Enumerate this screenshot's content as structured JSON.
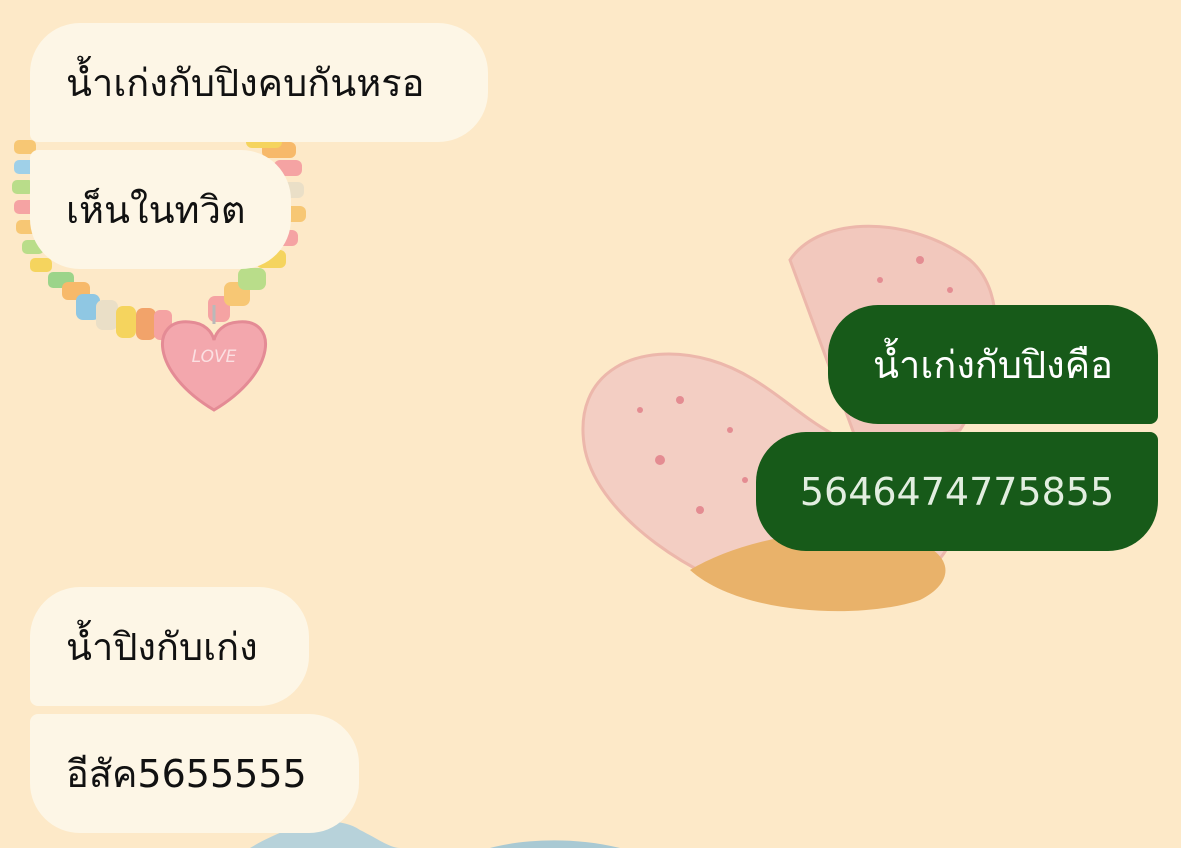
{
  "wallpaper": {
    "background_color": "#fde9c8",
    "decorations": [
      "candy-bracelet-icon",
      "heart-cookie-icon",
      "blue-ribbon-icon"
    ]
  },
  "colors": {
    "incoming_bubble": "#fdf6e6",
    "outgoing_bubble": "#175a19",
    "incoming_text": "#111111",
    "outgoing_text": "#ffffff"
  },
  "messages": [
    {
      "direction": "incoming",
      "text": "น้ำเก่งกับปิงคบกันหรอ"
    },
    {
      "direction": "incoming",
      "text": "เห็นในทวิต"
    },
    {
      "direction": "outgoing",
      "text": "น้ำเก่งกับปิงคือ"
    },
    {
      "direction": "outgoing",
      "text": "5646474775855"
    },
    {
      "direction": "incoming",
      "text": "น้ำปิงกับเก่ง"
    },
    {
      "direction": "incoming",
      "text": "อีสัค5655555"
    }
  ]
}
